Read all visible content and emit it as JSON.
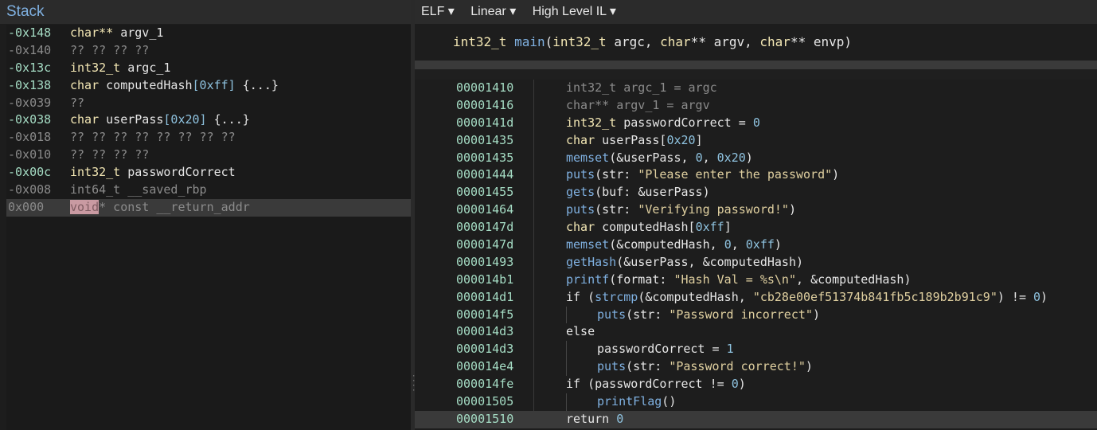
{
  "left_panel": {
    "title": "Stack"
  },
  "stack_rows": [
    {
      "off": "-0x148",
      "type": "char**",
      "rest": " argv_1",
      "dim": false
    },
    {
      "off": "-0x140",
      "type": "",
      "rest": "?? ?? ?? ??",
      "dim": true
    },
    {
      "off": "-0x13c",
      "type": "int32_t",
      "rest": " argc_1",
      "dim": false
    },
    {
      "off": "-0x138",
      "type": "char",
      "rest": " computedHash",
      "br": "[0xff]",
      "tail": " {...}",
      "dim": false
    },
    {
      "off": "-0x039",
      "type": "",
      "rest": "??",
      "dim": true
    },
    {
      "off": "-0x038",
      "type": "char",
      "rest": " userPass",
      "br": "[0x20]",
      "tail": " {...}",
      "dim": false
    },
    {
      "off": "-0x018",
      "type": "",
      "rest": "?? ?? ?? ?? ?? ?? ?? ??",
      "dim": true
    },
    {
      "off": "-0x010",
      "type": "",
      "rest": "?? ?? ?? ??",
      "dim": true
    },
    {
      "off": "-0x00c",
      "type": "int32_t",
      "rest": " passwordCorrect",
      "dim": false
    },
    {
      "off": "-0x008",
      "type": "int64_t",
      "rest": " __saved_rbp",
      "dim": true
    },
    {
      "off": "0x000",
      "type": "void",
      "rest": "* const __return_addr",
      "dim": true,
      "selected": true
    }
  ],
  "toolbar": {
    "view1": "ELF ▾",
    "view2": "Linear ▾",
    "view3": "High Level IL ▾"
  },
  "signature": "int32_t main(int32_t argc, char** argv, char** envp)",
  "code_lines": [
    {
      "addr": "00001410",
      "text": "int32_t argc_1 = argc"
    },
    {
      "addr": "00001416",
      "text": "char** argv_1 = argv"
    },
    {
      "addr": "0000141d",
      "text": "int32_t passwordCorrect = 0"
    },
    {
      "addr": "00001435",
      "text": "char userPass[0x20]"
    },
    {
      "addr": "00001435",
      "text": "memset(&userPass, 0, 0x20)"
    },
    {
      "addr": "00001444",
      "text": "puts(str: \"Please enter the password\")"
    },
    {
      "addr": "00001455",
      "text": "gets(buf: &userPass)"
    },
    {
      "addr": "00001464",
      "text": "puts(str: \"Verifying password!\")"
    },
    {
      "addr": "0000147d",
      "text": "char computedHash[0xff]"
    },
    {
      "addr": "0000147d",
      "text": "memset(&computedHash, 0, 0xff)"
    },
    {
      "addr": "00001493",
      "text": "getHash(&userPass, &computedHash)"
    },
    {
      "addr": "000014b1",
      "text": "printf(format: \"Hash Val = %s\\n\", &computedHash)"
    },
    {
      "addr": "000014d1",
      "text": "if (strcmp(&computedHash, \"cb28e00ef51374b841fb5c189b2b91c9\") != 0)"
    },
    {
      "addr": "000014f5",
      "text": "puts(str: \"Password incorrect\")",
      "indent": 1
    },
    {
      "addr": "000014d3",
      "text": "else"
    },
    {
      "addr": "000014d3",
      "text": "passwordCorrect = 1",
      "indent": 1
    },
    {
      "addr": "000014e4",
      "text": "puts(str: \"Password correct!\")",
      "indent": 1
    },
    {
      "addr": "000014fe",
      "text": "if (passwordCorrect != 0)"
    },
    {
      "addr": "00001505",
      "text": "printFlag()",
      "indent": 1
    },
    {
      "addr": "00001510",
      "text": "return 0",
      "selected": true
    }
  ]
}
